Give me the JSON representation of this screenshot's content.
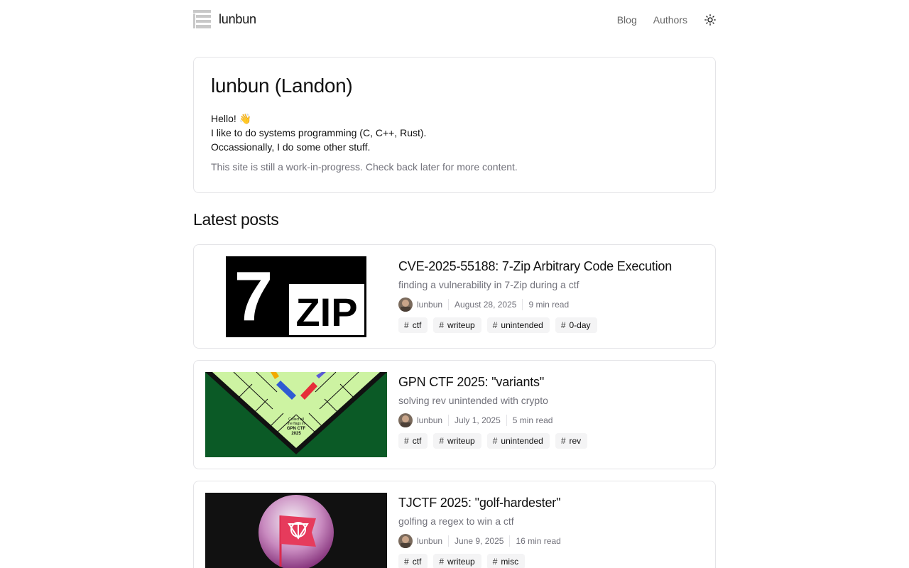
{
  "site": {
    "name": "lunbun"
  },
  "nav": {
    "blog": "Blog",
    "authors": "Authors",
    "theme_icon": "sun-icon"
  },
  "intro": {
    "title": "lunbun (Landon)",
    "line1": "Hello! 👋",
    "line2": "I like to do systems programming (C, C++, Rust).",
    "line3": "Occassionally, I do some other stuff.",
    "note": "This site is still a work-in-progress. Check back later for more content."
  },
  "latest_posts_heading": "Latest posts",
  "posts": [
    {
      "title": "CVE-2025-55188: 7-Zip Arbitrary Code Execution",
      "description": "finding a vulnerability in 7-Zip during a ctf",
      "author": "lunbun",
      "date": "August 28, 2025",
      "read_time": "9 min read",
      "tags": [
        "ctf",
        "writeup",
        "unintended",
        "0-day"
      ],
      "image_text": {
        "seven": "7",
        "zip": "ZIP"
      }
    },
    {
      "title": "GPN CTF 2025: \"variants\"",
      "description": "solving rev unintended with crypto",
      "author": "lunbun",
      "date": "July 1, 2025",
      "read_time": "5 min read",
      "tags": [
        "ctf",
        "writeup",
        "unintended",
        "rev"
      ],
      "image_text": {
        "corner_line1": "Collect all",
        "corner_line2": "the flags in",
        "corner_line3": "GPN CTF",
        "corner_line4": "2025"
      }
    },
    {
      "title": "TJCTF 2025: \"golf-hardester\"",
      "description": "golfing a regex to win a ctf",
      "author": "lunbun",
      "date": "June 9, 2025",
      "read_time": "16 min read",
      "tags": [
        "ctf",
        "writeup",
        "misc"
      ]
    }
  ],
  "colors": {
    "border": "#e4e4e7",
    "muted": "#71717a",
    "tag_bg": "#f4f4f5",
    "monopoly_green": "#0b5a26",
    "monopoly_board": "#cdf3a2",
    "flag_red": "#e63b5c"
  }
}
